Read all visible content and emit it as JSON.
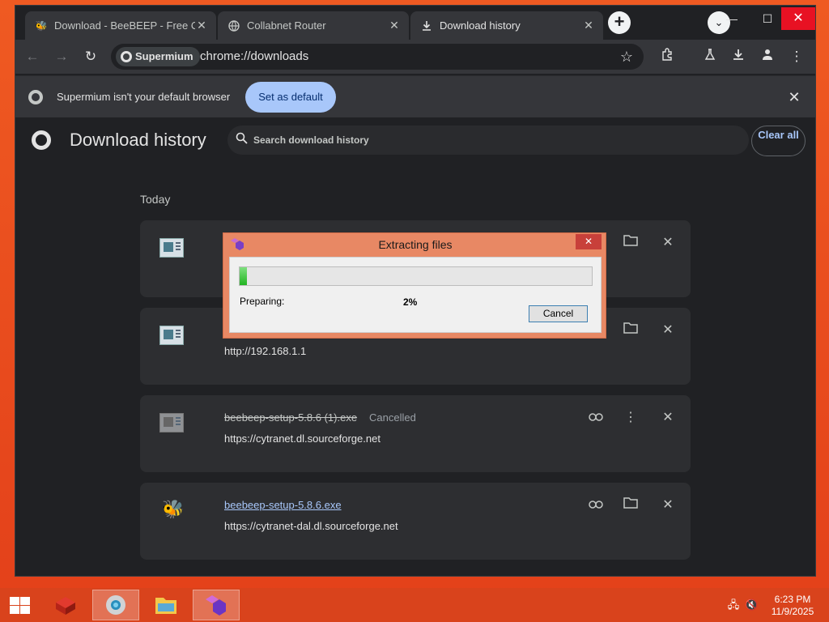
{
  "browser": {
    "tabs": [
      {
        "title": "Download - BeeBEEP - Free Offi",
        "icon": "bee-icon"
      },
      {
        "title": "Collabnet Router",
        "icon": "globe-icon"
      },
      {
        "title": "Download history",
        "icon": "download-icon"
      }
    ],
    "active_tab": 2,
    "site_chip": "Supermium",
    "url": "chrome://downloads",
    "infobar": {
      "message": "Supermium isn't your default browser",
      "button": "Set as default"
    }
  },
  "downloads_page": {
    "title": "Download history",
    "search_placeholder": "Search download history",
    "clear_all": "Clear all",
    "section": "Today",
    "items": [
      {
        "name": "",
        "status": "",
        "url": "",
        "icon": "installer-icon"
      },
      {
        "name": "",
        "status": "",
        "url": "http://192.168.1.1",
        "icon": "installer-icon"
      },
      {
        "name": "beebeep-setup-5.8.6 (1).exe",
        "status": "Cancelled",
        "url": "https://cytranet.dl.sourceforge.net",
        "icon": "installer-icon"
      },
      {
        "name": "beebeep-setup-5.8.6.exe",
        "status": "",
        "url": "https://cytranet-dal.dl.sourceforge.net",
        "icon": "bee-icon"
      }
    ]
  },
  "dialog": {
    "title": "Extracting files",
    "status_label": "Preparing:",
    "percent_text": "2%",
    "progress": 0.02,
    "cancel": "Cancel"
  },
  "taskbar": {
    "time": "6:23 PM",
    "date": "11/9/2025"
  },
  "colors": {
    "desktop": "#e8481d",
    "accent": "#a8c7fa",
    "dialog_frame": "#e88864"
  }
}
